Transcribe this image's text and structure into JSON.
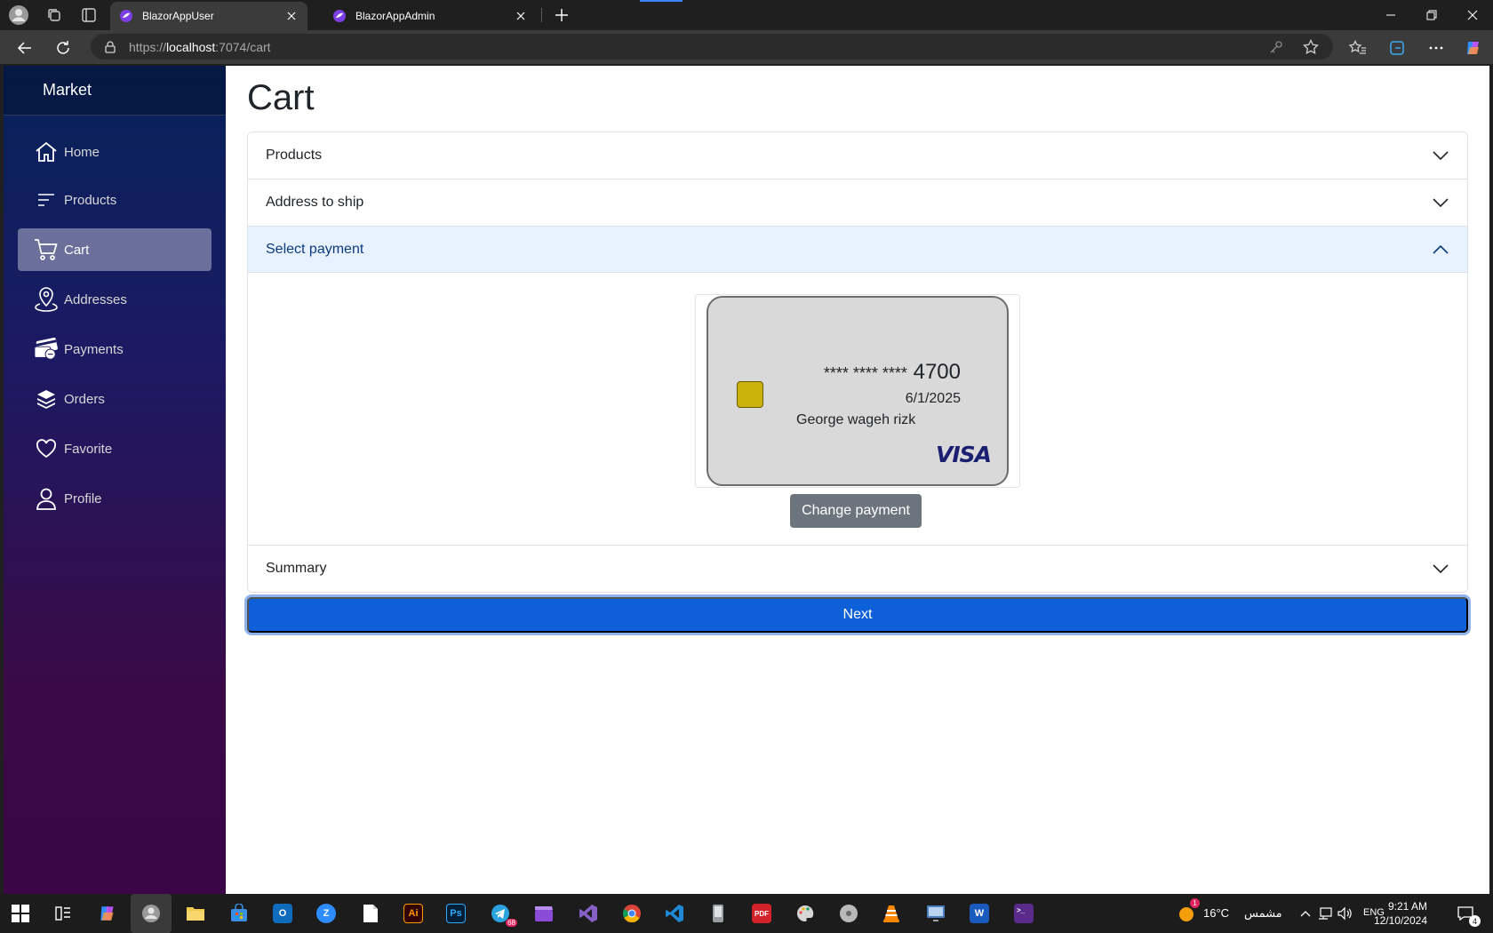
{
  "browser": {
    "tabs": [
      {
        "title": "BlazorAppUser",
        "active": true
      },
      {
        "title": "BlazorAppAdmin",
        "active": false
      }
    ],
    "url_scheme": "https://",
    "url_host": "localhost",
    "url_rest": ":7074/cart"
  },
  "sidebar": {
    "brand": "Market",
    "items": [
      {
        "label": "Home",
        "icon": "home-icon"
      },
      {
        "label": "Products",
        "icon": "list-icon"
      },
      {
        "label": "Cart",
        "icon": "cart-icon",
        "active": true
      },
      {
        "label": "Addresses",
        "icon": "location-pin-icon"
      },
      {
        "label": "Payments",
        "icon": "payment-card-icon"
      },
      {
        "label": "Orders",
        "icon": "layers-icon"
      },
      {
        "label": "Favorite",
        "icon": "heart-icon"
      },
      {
        "label": "Profile",
        "icon": "person-icon"
      }
    ]
  },
  "page": {
    "title": "Cart",
    "sections": [
      {
        "label": "Products",
        "open": false
      },
      {
        "label": "Address to ship",
        "open": false
      },
      {
        "label": "Select payment",
        "open": true
      },
      {
        "label": "Summary",
        "open": false
      }
    ],
    "card": {
      "mask": "**** **** ****",
      "last4": "4700",
      "expiry": "6/1/2025",
      "holder": "George wageh rizk",
      "brand": "VISA"
    },
    "change_payment_label": "Change payment",
    "next_label": "Next"
  },
  "taskbar": {
    "weather_temp": "16°C",
    "weather_text": "مشمس",
    "weather_badge": "1",
    "language": "ENG",
    "time": "9:21 AM",
    "date": "12/10/2024",
    "notifications": "4",
    "telegram_badge": "68"
  },
  "colors": {
    "primary": "#0d60d8",
    "secondary": "#6c757d",
    "accordion_open_bg": "#e7f1ff",
    "chip": "#cbb20d",
    "visa": "#1a1f71"
  }
}
